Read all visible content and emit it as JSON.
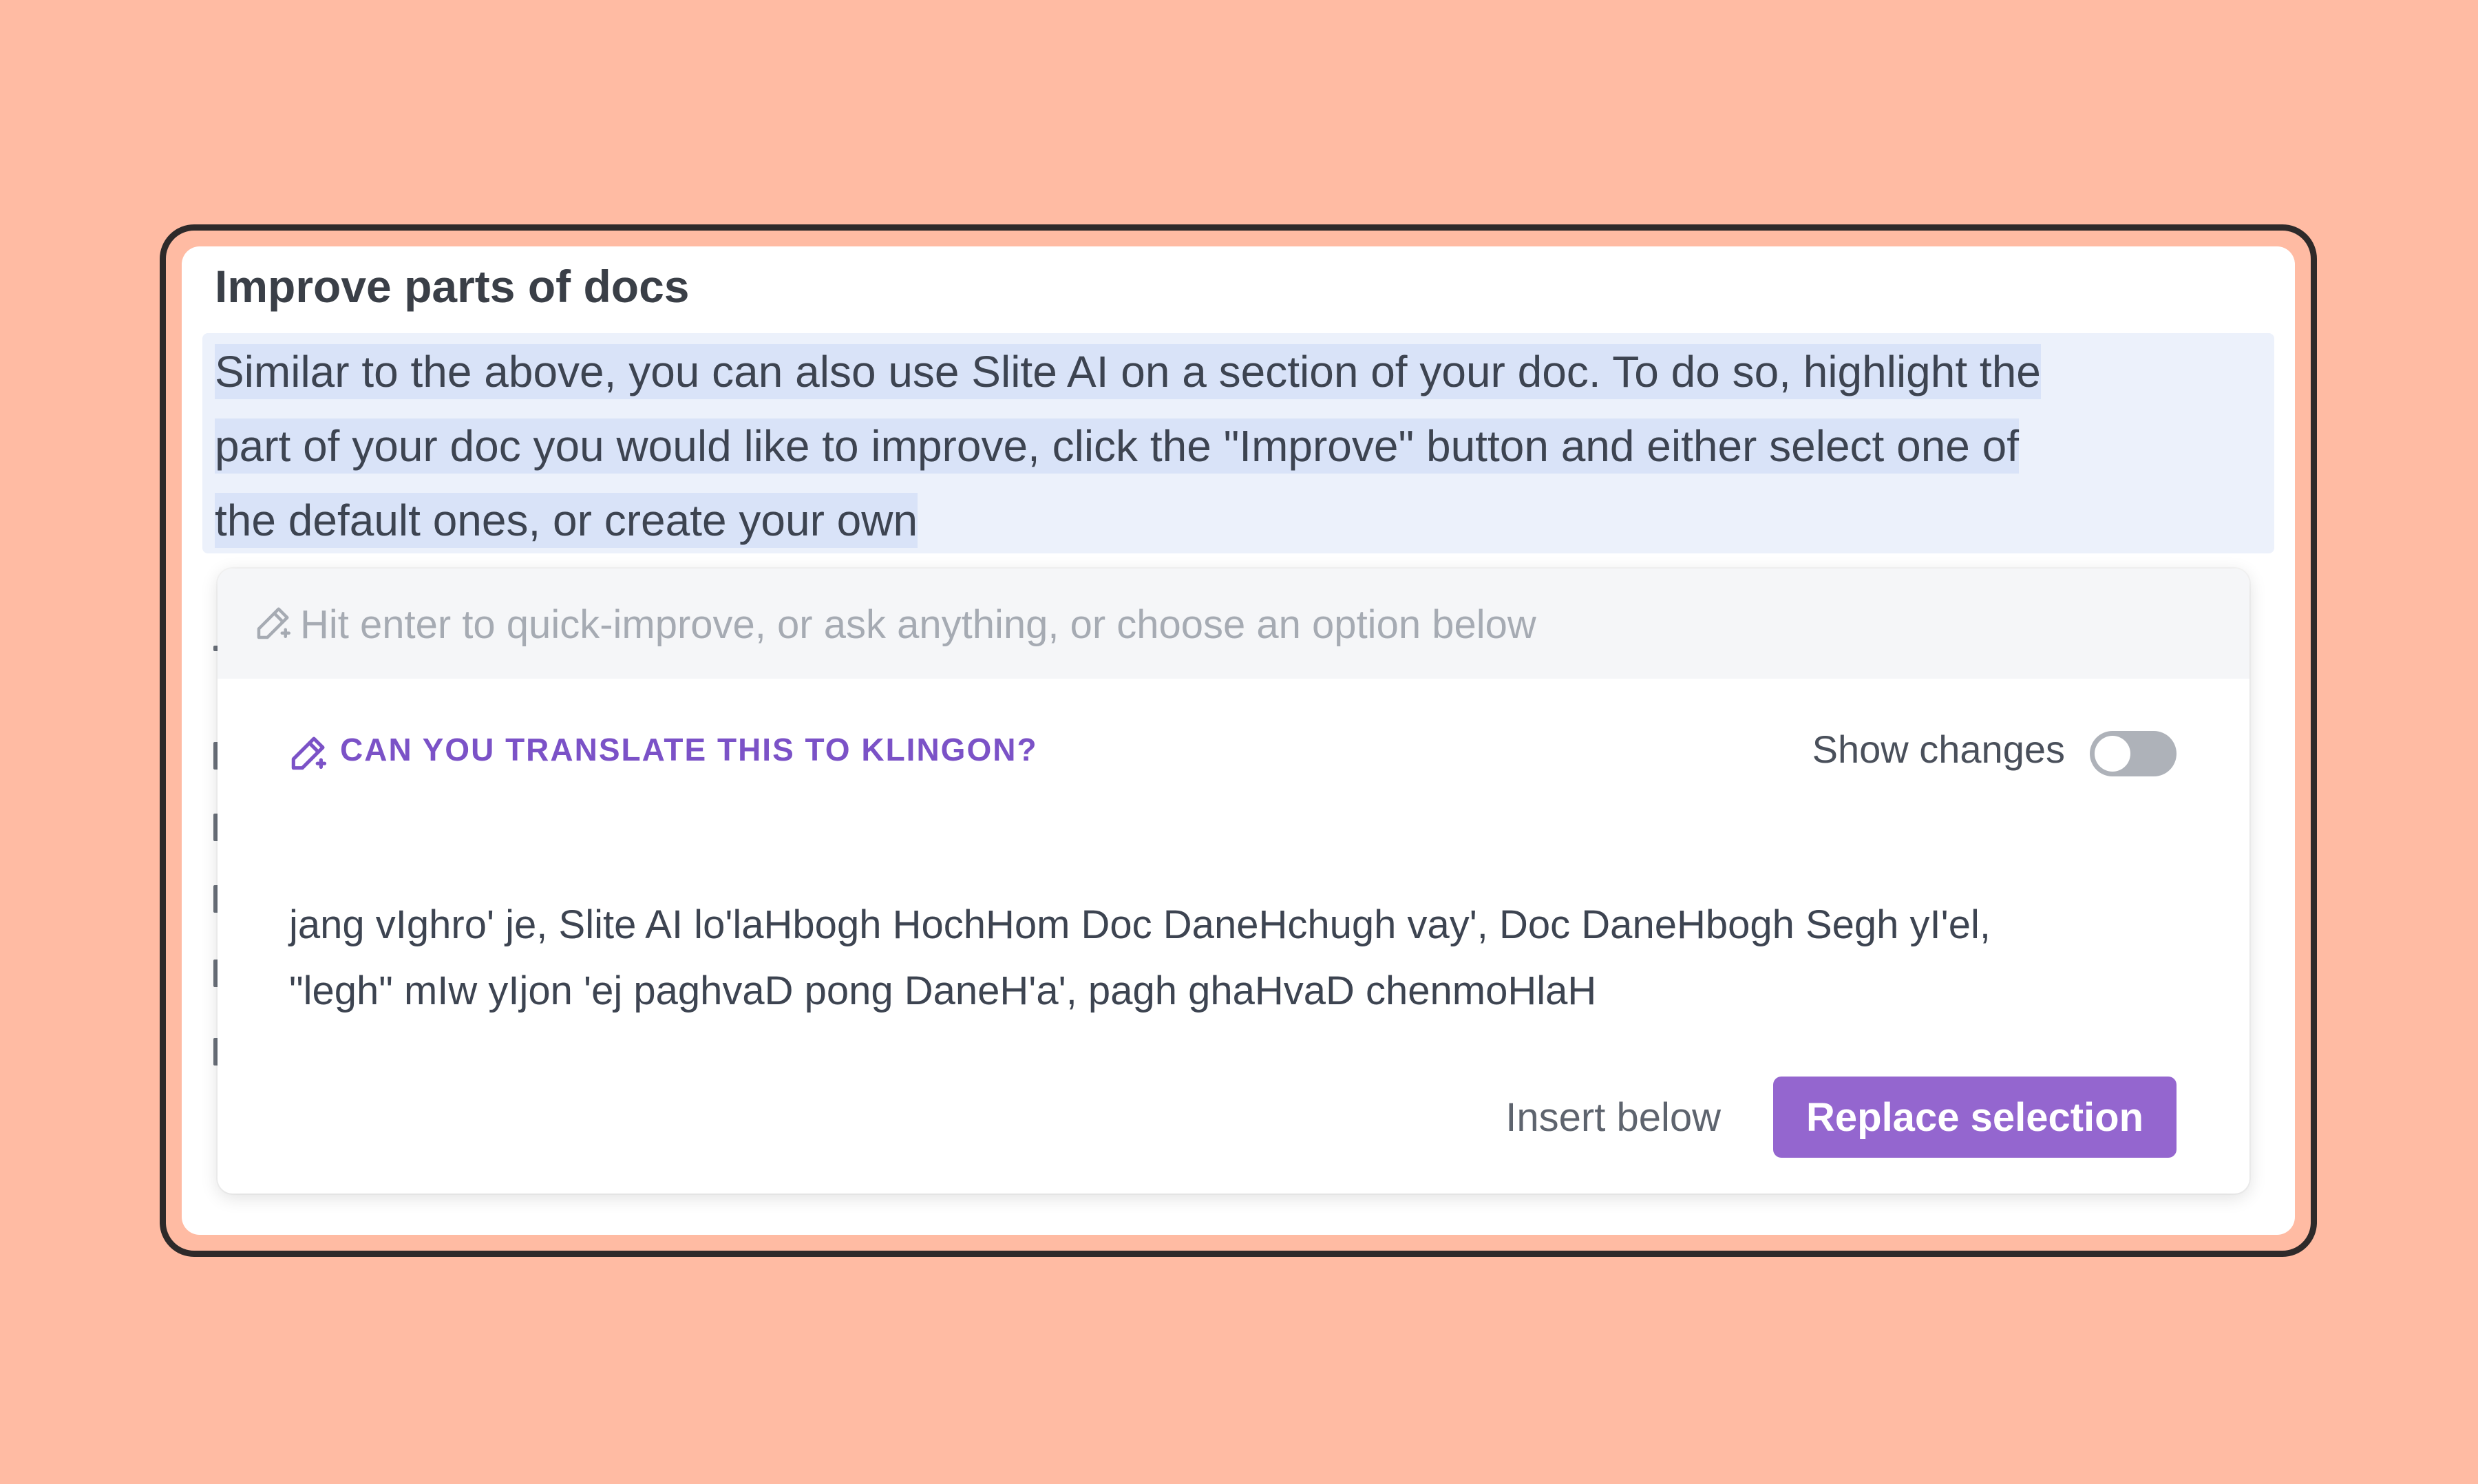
{
  "document": {
    "heading": "Improve parts of docs",
    "selected_paragraph_lines": [
      "Similar to the above, you can also use Slite AI on a section of your doc. To do so, highlight the",
      "part of your doc you would like to improve, click the \"Improve\" button and either select one of",
      "the default ones, or create your own"
    ]
  },
  "ai_popover": {
    "prompt_placeholder": "Hit enter to quick-improve, or ask anything, or choose an option below",
    "prompt_icon": "magic-pen-icon",
    "query_label": "CAN YOU TRANSLATE THIS TO KLINGON?",
    "query_icon": "magic-pen-icon",
    "show_changes_label": "Show changes",
    "show_changes_enabled": false,
    "result_lines": [
      "jang vIghro' je, Slite AI lo'laHbogh HochHom Doc DaneHchugh vay', Doc DaneHbogh Segh yI'el,",
      "\"legh\" mIw yIjon 'ej paghvaD pong DaneH'a', pagh ghaHvaD chenmoHlaH"
    ],
    "insert_below_label": "Insert below",
    "replace_selection_label": "Replace selection"
  },
  "colors": {
    "background": "#FFBBA3",
    "accent": "#9466CF",
    "query_text": "#7B52C7",
    "selection_highlight": "#D9E3F8",
    "toggle_off": "#AEB2B9"
  }
}
